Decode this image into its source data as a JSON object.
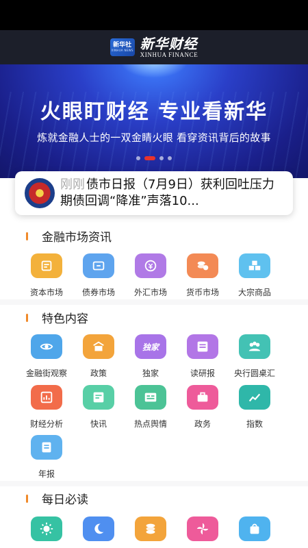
{
  "header": {
    "logo_badge": "新华社",
    "logo_badge_sub": "XINHUA NEWS",
    "logo_cn": "新华财经",
    "logo_en": "XINHUA FINANCE"
  },
  "banner": {
    "title": "火眼盯财经  专业看新华",
    "subtitle": "炼就金融人士的一双金睛火眼  看穿资讯背后的故事"
  },
  "news": {
    "tag": "刚刚",
    "headline": "债市日报（7月9日）获利回吐压力期债回调“降准”声落10..."
  },
  "sections": [
    {
      "title": "金融市场资讯",
      "items": [
        {
          "label": "资本市场",
          "icon": "capital-market-icon",
          "color": "#f3b13b"
        },
        {
          "label": "债券市场",
          "icon": "bond-market-icon",
          "color": "#5ea4ee"
        },
        {
          "label": "外汇市场",
          "icon": "forex-market-icon",
          "color": "#b07ae6"
        },
        {
          "label": "货币市场",
          "icon": "money-market-icon",
          "color": "#f38a55"
        },
        {
          "label": "大宗商品",
          "icon": "commodities-icon",
          "color": "#5fc1ef"
        }
      ]
    },
    {
      "title": "特色内容",
      "items": [
        {
          "label": "金融街观察",
          "icon": "eye-icon",
          "color": "#4fa6ea"
        },
        {
          "label": "政策",
          "icon": "policy-icon",
          "color": "#f3a43b"
        },
        {
          "label": "独家",
          "icon": "exclusive-icon",
          "color": "#a874e8",
          "text": "独家"
        },
        {
          "label": "读研报",
          "icon": "report-icon",
          "color": "#b276e6"
        },
        {
          "label": "央行圆桌汇",
          "icon": "roundtable-icon",
          "color": "#43c2b4"
        },
        {
          "label": "财经分析",
          "icon": "analysis-icon",
          "color": "#f26c4a"
        },
        {
          "label": "快讯",
          "icon": "flash-news-icon",
          "color": "#58cfa6"
        },
        {
          "label": "热点舆情",
          "icon": "hot-topics-icon",
          "color": "#4cc396"
        },
        {
          "label": "政务",
          "icon": "government-icon",
          "color": "#ee5b9a"
        },
        {
          "label": "指数",
          "icon": "index-icon",
          "color": "#2fb7a9"
        },
        {
          "label": "年报",
          "icon": "annual-report-icon",
          "color": "#5fb2ef"
        }
      ]
    },
    {
      "title": "每日必读",
      "items": [
        {
          "label": "",
          "icon": "sun-icon",
          "color": "#36c2a3"
        },
        {
          "label": "",
          "icon": "moon-icon",
          "color": "#4f8ff0"
        },
        {
          "label": "",
          "icon": "coins-icon",
          "color": "#f3a43b"
        },
        {
          "label": "",
          "icon": "pinwheel-icon",
          "color": "#ee5b9a"
        },
        {
          "label": "",
          "icon": "bag-icon",
          "color": "#4fb3ef"
        }
      ]
    }
  ]
}
